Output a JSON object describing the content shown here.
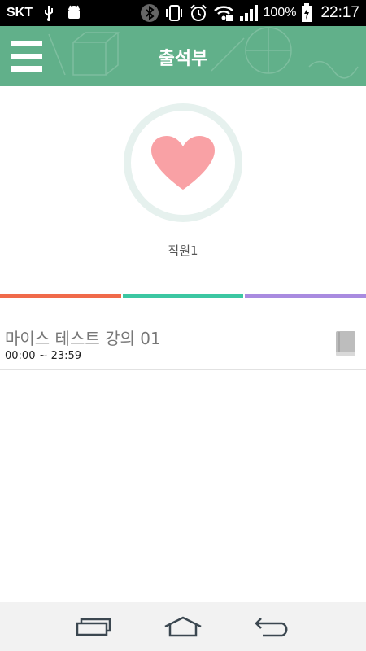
{
  "status_bar": {
    "carrier": "SKT",
    "battery": "100%",
    "time": "22:17",
    "icons": [
      "usb-icon",
      "android-debug-icon",
      "bluetooth-icon",
      "vibrate-icon",
      "alarm-icon",
      "wifi-icon",
      "signal-icon",
      "battery-charging-icon"
    ]
  },
  "header": {
    "title": "출석부",
    "menu_icon": "hamburger-menu-icon"
  },
  "profile": {
    "name": "직원1",
    "avatar_icon": "heart-icon",
    "heart_color": "#f9a1a5"
  },
  "tabs": {
    "colors": [
      "#f06a4a",
      "#3cc7a2",
      "#a98be0"
    ]
  },
  "lectures": [
    {
      "title": "마이스 테스트 강의 01",
      "time": "00:00 ~ 23:59",
      "icon": "book-icon"
    }
  ],
  "nav": {
    "buttons": [
      "recent-apps-icon",
      "home-icon",
      "back-icon"
    ]
  },
  "colors": {
    "header": "#61b08a",
    "status_bar": "#000000",
    "nav_bar": "#f2f2f2"
  }
}
